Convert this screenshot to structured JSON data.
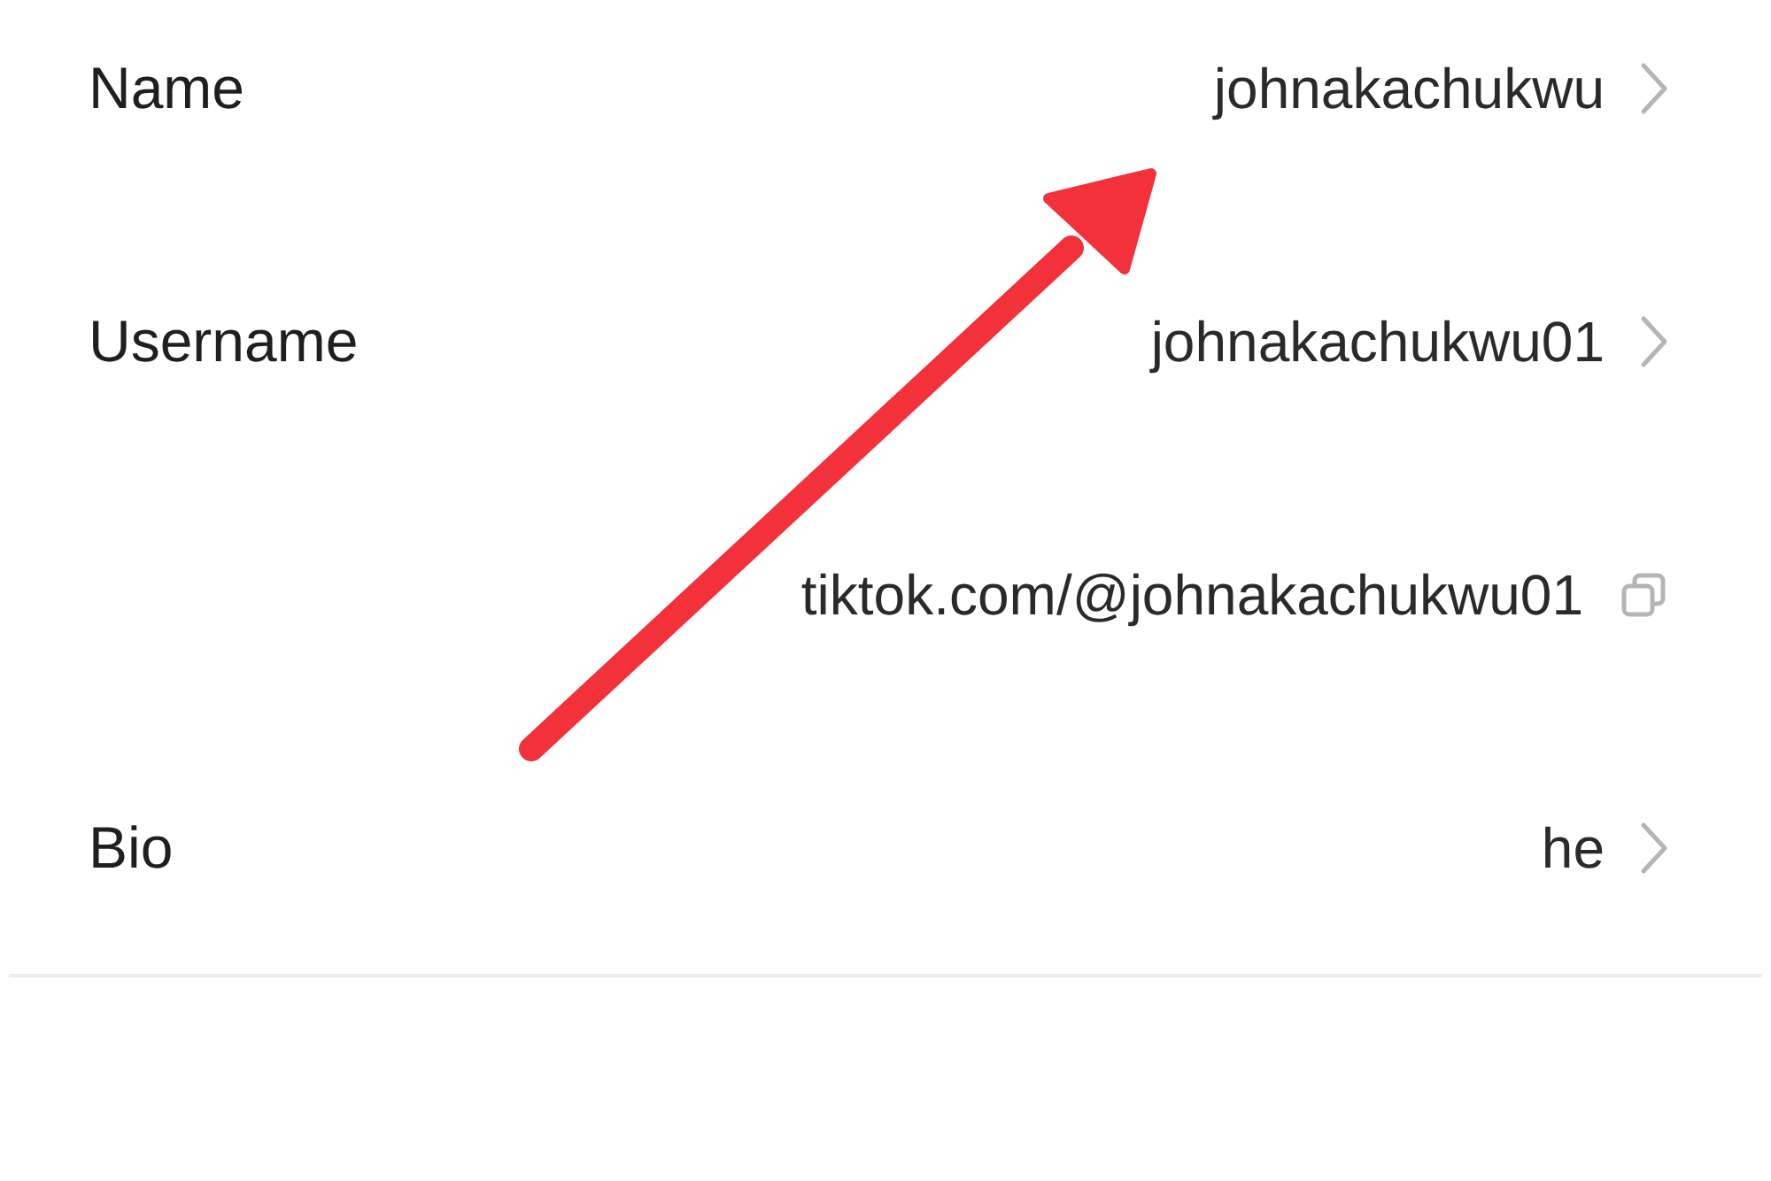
{
  "rows": [
    {
      "kind": "setting",
      "label": "Name",
      "value": "johnakachukwu"
    },
    {
      "kind": "setting",
      "label": "Username",
      "value": "johnakachukwu01"
    },
    {
      "kind": "link",
      "value": "tiktok.com/@johnakachukwu01"
    },
    {
      "kind": "setting",
      "label": "Bio",
      "value": "he"
    }
  ]
}
